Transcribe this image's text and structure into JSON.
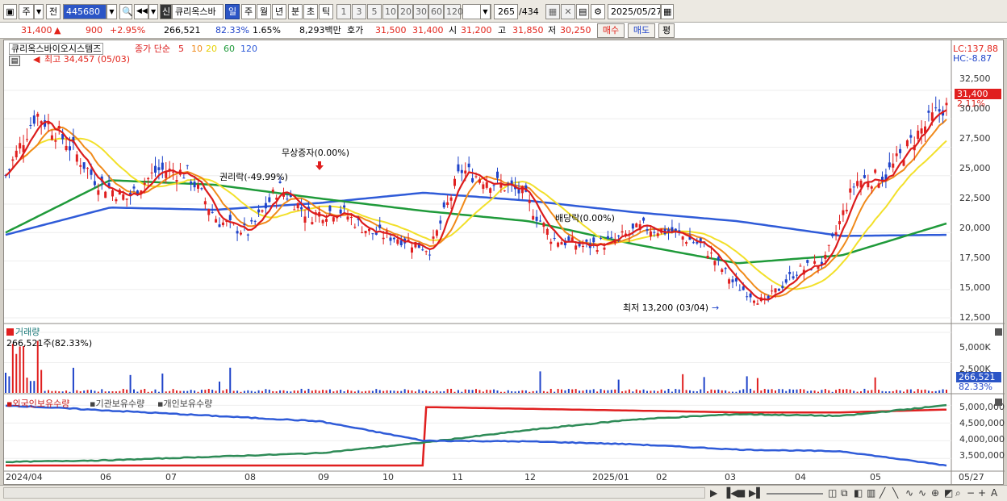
{
  "toolbar": {
    "mode_main": "주",
    "mode_jeon": "전",
    "code": "445680",
    "company_badge": "신",
    "company": "큐리옥스바",
    "period_tabs": [
      "일",
      "주",
      "월",
      "년",
      "분",
      "초",
      "틱"
    ],
    "selected_period": "일",
    "interval_buttons": [
      "1",
      "3",
      "5",
      "10",
      "20",
      "30",
      "60",
      "120"
    ],
    "count_display": "265",
    "count_total": "/434",
    "date": "2025/05/27"
  },
  "quote": {
    "price": "31,400",
    "change": "900",
    "change_rate": "+2.95%",
    "volume": "266,521",
    "vol_ratio": "82.33%",
    "turnover": "1.65%",
    "amount": "8,293백만",
    "hoga_label": "호가",
    "hoga_ask": "31,500",
    "hoga_bid": "31,400",
    "open_label": "시",
    "open": "31,200",
    "high_label": "고",
    "high": "31,850",
    "low_label": "저",
    "low": "30,250",
    "buy_button": "매수",
    "sell_button": "매도",
    "eval_button": "평"
  },
  "price_pane": {
    "name": "큐리옥스바이오시스템즈",
    "ma_label": "종가 단순",
    "ma_periods": [
      "5",
      "10",
      "20",
      "60",
      "120"
    ],
    "ma_colors": [
      "#dc1c1c",
      "#f08a1a",
      "#f2e02a",
      "#1f9a3a",
      "#2f5bd8"
    ],
    "high_annotation": "최고 34,457 (05/03)",
    "low_annotation": "최저 13,200 (03/04)",
    "event_1": "무상증자(0.00%)",
    "event_2": "권리락(-49.99%)",
    "event_3": "배당락(0.00%)",
    "lc": "LC:137.88",
    "hc": "HC:-8.87",
    "current_tag": "31,400",
    "current_pct": "2.11%",
    "y_ticks": [
      "32,500",
      "30,000",
      "27,500",
      "25,000",
      "22,500",
      "20,000",
      "17,500",
      "15,000",
      "12,500"
    ]
  },
  "volume_pane": {
    "title": "거래량",
    "value": "266,521주(82.33%)",
    "tag": "266,521",
    "tag_pct": "82.33%",
    "y_ticks": [
      "5,000K",
      "2,500K"
    ]
  },
  "holding_pane": {
    "foreign": "외국인보유수량",
    "institution": "기관보유수량",
    "individual": "개인보유수량",
    "y_ticks": [
      "5,000,000",
      "4,500,000",
      "4,000,000",
      "3,500,000"
    ]
  },
  "x_axis": [
    "2024/04",
    "06",
    "07",
    "08",
    "09",
    "10",
    "11",
    "12",
    "2025/01",
    "02",
    "03",
    "04",
    "05",
    "05/27"
  ],
  "chart_data": {
    "type": "candlestick",
    "price_ylim": [
      12500,
      32500
    ],
    "price_close_trend": [
      {
        "x": "2024/04",
        "y": 25000
      },
      {
        "x": "2024/04",
        "y": 30500
      },
      {
        "x": "2024/04",
        "y": 28000
      },
      {
        "x": "06",
        "y": 24500
      },
      {
        "x": "06",
        "y": 23000
      },
      {
        "x": "06",
        "y": 25500
      },
      {
        "x": "07",
        "y": 25200
      },
      {
        "x": "07",
        "y": 21000
      },
      {
        "x": "07",
        "y": 20000
      },
      {
        "x": "08",
        "y": 24000
      },
      {
        "x": "08",
        "y": 21500
      },
      {
        "x": "08",
        "y": 22000
      },
      {
        "x": "09",
        "y": 20000
      },
      {
        "x": "09",
        "y": 19500
      },
      {
        "x": "10",
        "y": 18500
      },
      {
        "x": "10",
        "y": 25500
      },
      {
        "x": "10",
        "y": 24500
      },
      {
        "x": "11",
        "y": 23500
      },
      {
        "x": "11",
        "y": 19500
      },
      {
        "x": "12",
        "y": 18800
      },
      {
        "x": "12",
        "y": 19200
      },
      {
        "x": "2025/01",
        "y": 20500
      },
      {
        "x": "2025/01",
        "y": 20000
      },
      {
        "x": "02",
        "y": 18800
      },
      {
        "x": "02",
        "y": 15500
      },
      {
        "x": "03",
        "y": 13800
      },
      {
        "x": "03",
        "y": 16500
      },
      {
        "x": "04",
        "y": 17500
      },
      {
        "x": "04",
        "y": 24500
      },
      {
        "x": "05",
        "y": 25000
      },
      {
        "x": "05",
        "y": 28500
      },
      {
        "x": "05/27",
        "y": 31400
      }
    ],
    "ma120_trend": [
      19800,
      22200,
      22000,
      22600,
      23500,
      22800,
      21800,
      21000,
      19700,
      19800
    ],
    "ma60_trend": [
      20000,
      24600,
      24200,
      23000,
      21900,
      21000,
      19000,
      17300,
      18000,
      20800
    ],
    "volume_ylim": [
      0,
      5000000
    ],
    "holding_ylim": [
      3300000,
      5100000
    ],
    "holding_series": [
      {
        "name": "외국인보유수량",
        "color": "#e01f1f",
        "values": [
          3300000,
          3300000,
          3300000,
          3300000,
          4950000,
          4900000,
          4850000,
          4800000,
          4800000,
          4880000
        ]
      },
      {
        "name": "기관보유수량",
        "color": "#2e8b57",
        "values": [
          3400000,
          3450000,
          3550000,
          3650000,
          3950000,
          4300000,
          4600000,
          4750000,
          4700000,
          5000000
        ]
      },
      {
        "name": "개인보유수량",
        "color": "#2f5bd8",
        "values": [
          5000000,
          4850000,
          4700000,
          4550000,
          4000000,
          3980000,
          3900000,
          3750000,
          3700000,
          3300000
        ]
      }
    ]
  }
}
